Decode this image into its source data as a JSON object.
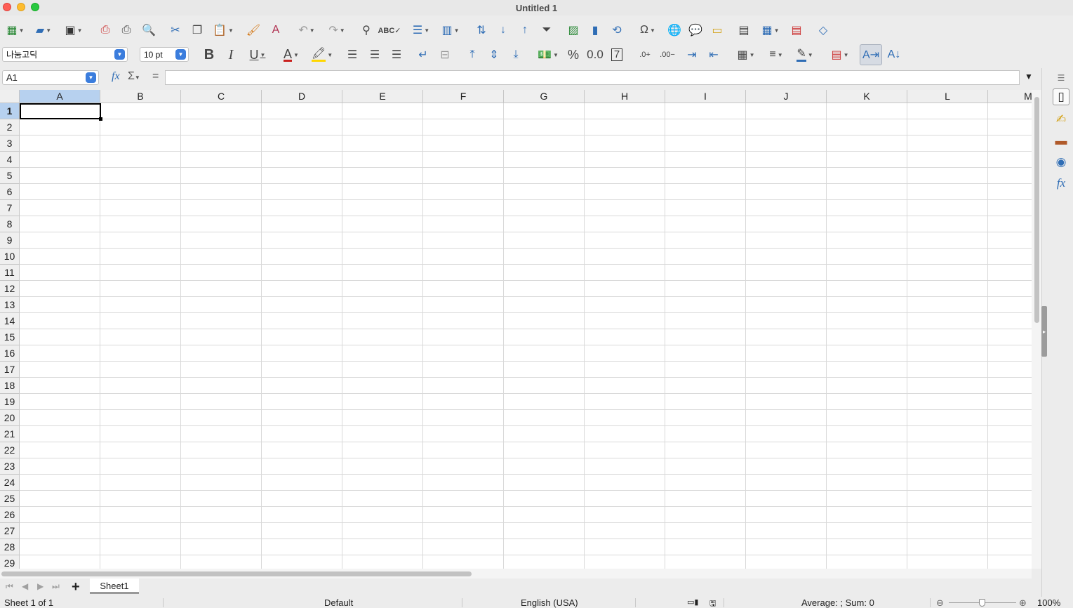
{
  "window": {
    "title": "Untitled 1"
  },
  "toolbar2": {
    "font_name": "나눔고딕",
    "font_size": "10 pt"
  },
  "formula_bar": {
    "name_box": "A1",
    "fx_label": "fx",
    "sum_label": "Σ",
    "equals_label": "=",
    "content": ""
  },
  "grid": {
    "columns": [
      "A",
      "B",
      "C",
      "D",
      "E",
      "F",
      "G",
      "H",
      "I",
      "J",
      "K",
      "L",
      "M"
    ],
    "rows": [
      "1",
      "2",
      "3",
      "4",
      "5",
      "6",
      "7",
      "8",
      "9",
      "10",
      "11",
      "12",
      "13",
      "14",
      "15",
      "16",
      "17",
      "18",
      "19",
      "20",
      "21",
      "22",
      "23",
      "24",
      "25",
      "26",
      "27",
      "28",
      "29"
    ],
    "selected_cell": "A1"
  },
  "sheets": {
    "tabs": [
      "Sheet1"
    ],
    "active": "Sheet1"
  },
  "status": {
    "sheet_info": "Sheet 1 of 1",
    "page_style": "Default",
    "language": "English (USA)",
    "selection_stats": "Average: ; Sum: 0",
    "zoom": "100%"
  },
  "colors": {
    "accent": "#3b7ddd",
    "selection_header": "#b7d1ef"
  }
}
